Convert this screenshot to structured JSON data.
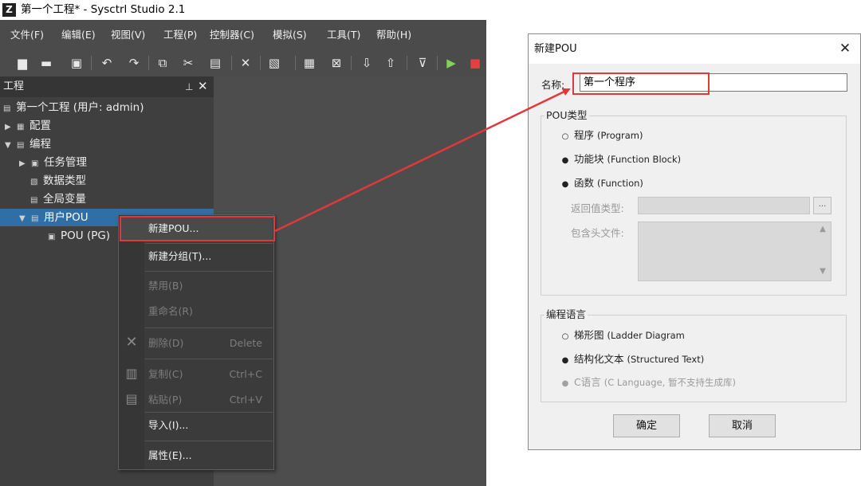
{
  "window": {
    "title": "第一个工程* - Sysctrl Studio 2.1",
    "logo_icon": "studio-logo-icon"
  },
  "menubar": [
    "文件(F)",
    "编辑(E)",
    "视图(V)",
    "工程(P)",
    "控制器(C)",
    "模拟(S)",
    "工具(T)",
    "帮助(H)"
  ],
  "toolbar_icons": [
    "new-file-icon",
    "open-folder-icon",
    "save-icon",
    "undo-icon",
    "redo-icon",
    "copy-icon",
    "cut-icon",
    "paste-icon",
    "delete-icon",
    "compile-icon",
    "build-icon",
    "clean-icon",
    "download-icon",
    "upload-icon",
    "connect-icon",
    "run-icon",
    "stop-icon"
  ],
  "panel": {
    "title": "工程",
    "tree": [
      {
        "label": "第一个工程 (用户: admin)"
      },
      {
        "label": "配置"
      },
      {
        "label": "编程"
      },
      {
        "label": "任务管理"
      },
      {
        "label": "数据类型"
      },
      {
        "label": "全局变量"
      },
      {
        "label": "用户POU",
        "selected": true
      },
      {
        "label": "POU (PG)"
      }
    ]
  },
  "context_menu": {
    "items": [
      {
        "label": "新建POU...",
        "shortcut": "",
        "enabled": true,
        "highlighted": true
      },
      {
        "label": "新建分组(T)...",
        "shortcut": "",
        "enabled": true
      },
      {
        "label": "禁用(B)",
        "shortcut": "",
        "enabled": false
      },
      {
        "label": "重命名(R)",
        "shortcut": "",
        "enabled": false
      },
      {
        "label": "删除(D)",
        "shortcut": "Delete",
        "enabled": false
      },
      {
        "label": "复制(C)",
        "shortcut": "Ctrl+C",
        "enabled": false
      },
      {
        "label": "粘贴(P)",
        "shortcut": "Ctrl+V",
        "enabled": false
      },
      {
        "label": "导入(I)...",
        "shortcut": "",
        "enabled": true
      },
      {
        "label": "属性(E)...",
        "shortcut": "",
        "enabled": true
      }
    ]
  },
  "dialog": {
    "title": "新建POU",
    "name_label": "名称:",
    "name_value": "第一个程序",
    "pou_type_group": "POU类型",
    "pou_types": [
      {
        "label": "程序",
        "en": "(Program)",
        "selected": true
      },
      {
        "label": "功能块",
        "en": "(Function Block)",
        "selected": false
      },
      {
        "label": "函数",
        "en": "(Function)",
        "selected": false
      }
    ],
    "return_type_label": "返回值类型:",
    "return_type_button": "...",
    "include_label": "包含头文件:",
    "lang_group": "编程语言",
    "languages": [
      {
        "label": "梯形图",
        "en": "(Ladder Diagram",
        "selected": true,
        "enabled": true
      },
      {
        "label": "结构化文本",
        "en": "(Structured Text)",
        "selected": false,
        "enabled": true
      },
      {
        "label": "C语言",
        "en": "(C Language, 暂不支持生成库)",
        "selected": false,
        "enabled": false
      }
    ],
    "ok": "确定",
    "cancel": "取消"
  },
  "colors": {
    "highlight": "#e0393c",
    "selection": "#2f6fa6",
    "ide_bg": "#4a4a4a"
  }
}
